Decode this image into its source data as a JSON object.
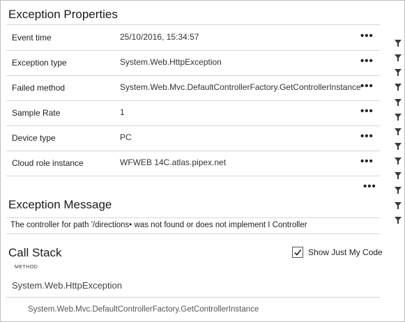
{
  "exception_properties": {
    "title": "Exception Properties",
    "rows": [
      {
        "key": "Event time",
        "value": "25/10/2016, 15:34:57"
      },
      {
        "key": "Exception type",
        "value": "System.Web.HttpException"
      },
      {
        "key": "Failed method",
        "value": "System.Web.Mvc.DefaultControllerFactory.GetControllerInstance"
      },
      {
        "key": "Sample Rate",
        "value": "1"
      },
      {
        "key": "Device type",
        "value": "PC"
      },
      {
        "key": "Cloud role instance",
        "value": "WFWEB 14C.atlas.pipex.net"
      }
    ],
    "more_glyph": "•••"
  },
  "exception_message": {
    "title": "Exception Message",
    "text": "The controller for path '/directions• was not found or does not implement I Controller"
  },
  "call_stack": {
    "title": "Call Stack",
    "show_just_my_code_label": "Show Just My Code",
    "show_just_my_code_checked": true,
    "column_header": "METHOD",
    "frames": [
      "System.Web.HttpException",
      "System.Web.Mvc.DefaultControllerFactory.GetControllerInstance"
    ]
  },
  "icons": {
    "filter": "filter-icon",
    "more": "more-options-icon",
    "check": "check-icon"
  },
  "colors": {
    "border": "#cfcfcf",
    "text": "#1e1e1e",
    "icon": "#3a3a3a"
  }
}
